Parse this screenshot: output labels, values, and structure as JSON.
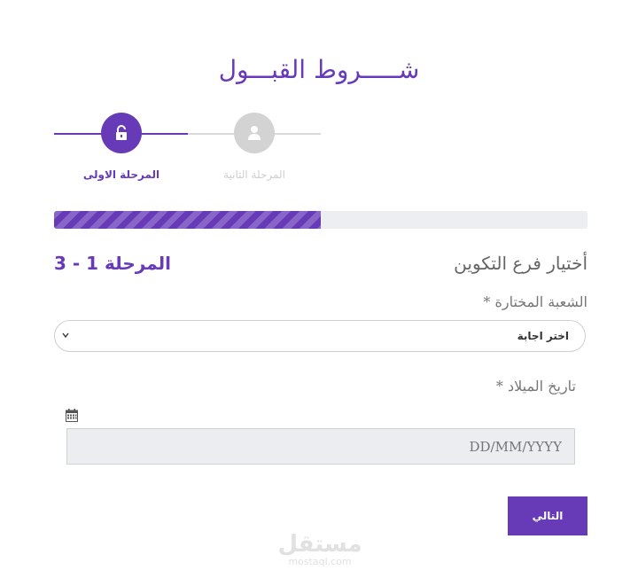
{
  "header": {
    "title": "شـــــروط القبـــول"
  },
  "stepper": {
    "steps": [
      {
        "label": "المرحلة الاولى",
        "icon": "unlock-icon",
        "active": true
      },
      {
        "label": "المرحلة الثانية",
        "icon": "user-icon",
        "active": false
      }
    ]
  },
  "progress": {
    "fraction": 0.5
  },
  "section": {
    "title": "أختيار فرع التكوين",
    "stage_counter": "المرحلة 1 - 3"
  },
  "form": {
    "specialty_label": "الشعبة المختارة *",
    "specialty_select_value": "اختر اجابة",
    "birthdate_label": "تاريخ الميلاد *",
    "birthdate_placeholder": "DD/MM/YYYY",
    "birthdate_value": ""
  },
  "actions": {
    "next_label": "التالي"
  },
  "watermark": {
    "main": "مستقل",
    "sub": "mostaql.com"
  },
  "colors": {
    "accent": "#673ab7",
    "inactive": "#d3d3d3",
    "progress_track": "#eceef1"
  }
}
